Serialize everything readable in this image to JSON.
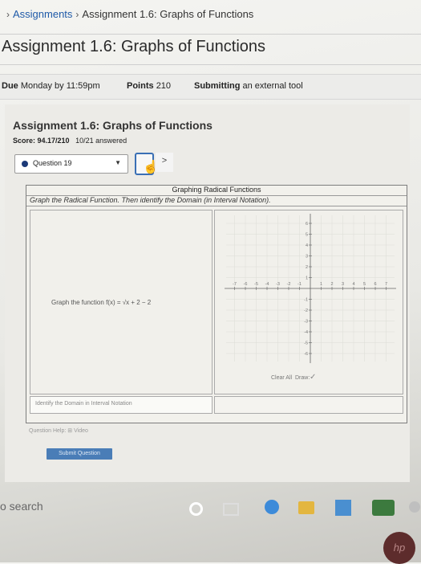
{
  "breadcrumb": {
    "items": [
      "Assignments",
      "Assignment 1.6: Graphs of Functions"
    ]
  },
  "page_title": "Assignment 1.6: Graphs of Functions",
  "meta": {
    "due_label": "Due",
    "due_value": "Monday by 11:59pm",
    "points_label": "Points",
    "points_value": "210",
    "submitting_label": "Submitting",
    "submitting_value": "an external tool"
  },
  "tool": {
    "title": "Assignment 1.6: Graphs of Functions",
    "score": "Score: 94.17/210",
    "answered": "10/21 answered",
    "question_selector": "Question 19",
    "next_arrow": ">",
    "question": {
      "heading": "Graphing Radical Functions",
      "instruction": "Graph the Radical Function. Then identify the Domain (in Interval Notation).",
      "function_prefix": "Graph the function",
      "function_expr": "f(x) = √x + 2 − 2",
      "graph": {
        "x_ticks": [
          "-7",
          "-6",
          "-5",
          "-4",
          "-3",
          "-2",
          "-1",
          "1",
          "2",
          "3",
          "4",
          "5",
          "6",
          "7"
        ],
        "y_ticks": [
          "6",
          "5",
          "4",
          "3",
          "2",
          "1",
          "-1",
          "-2",
          "-3",
          "-4",
          "-5",
          "-6"
        ]
      },
      "clear_all": "Clear All",
      "draw": "Draw:",
      "domain_placeholder": "Identify the Domain in Interval Notation"
    },
    "help_label": "Question Help:",
    "help_video": "Video",
    "submit_label": "Submit Question"
  },
  "taskbar": {
    "search": "o search"
  },
  "colors": {
    "link": "#1f5aa8",
    "submit_button": "#4a7db7",
    "question_dot": "#1c3a78"
  }
}
